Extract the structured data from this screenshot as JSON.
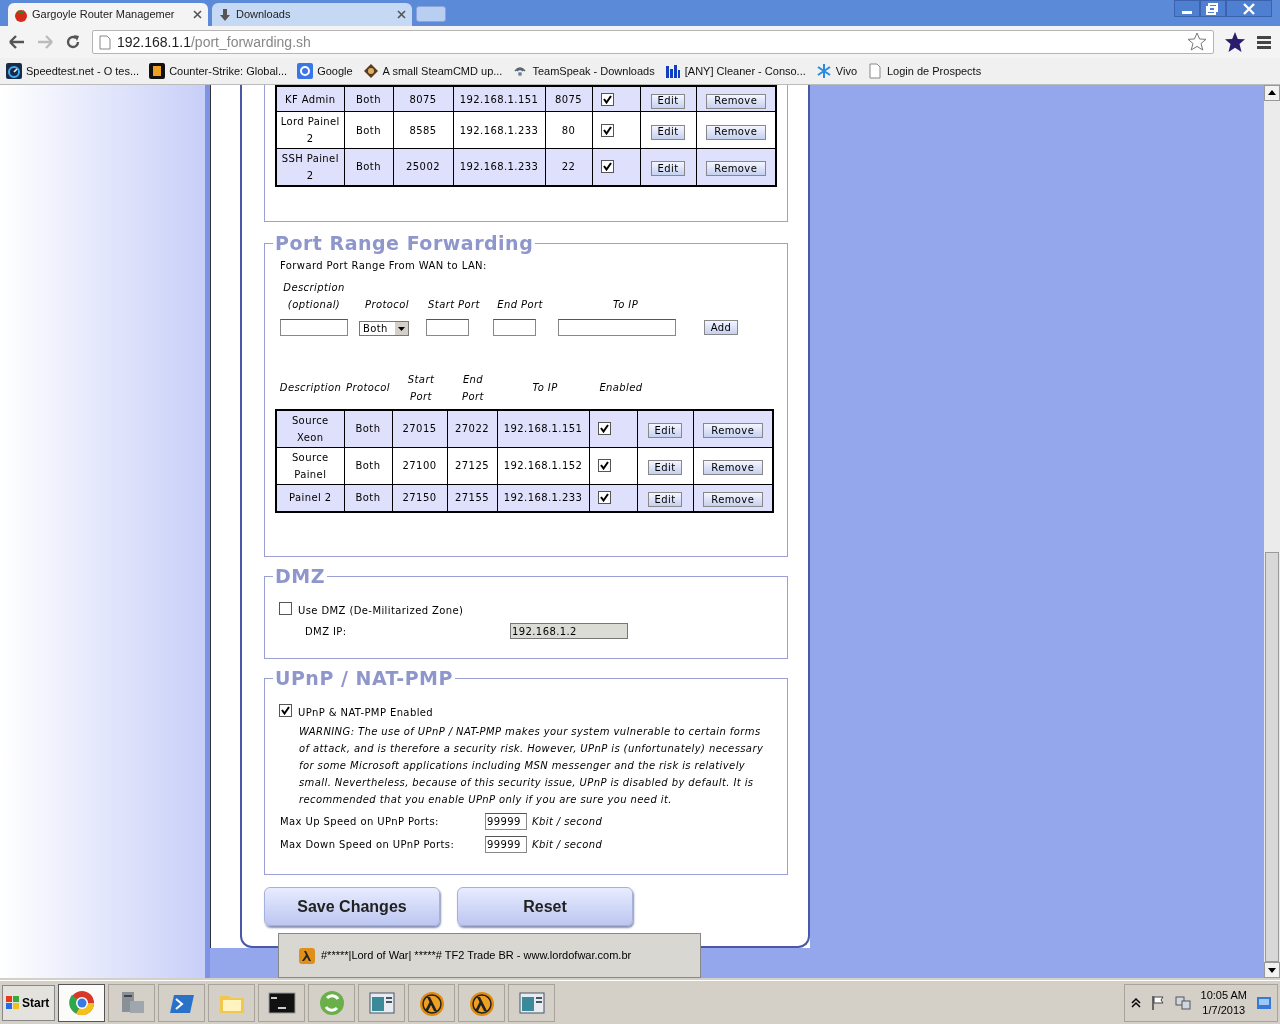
{
  "browser": {
    "tabs": [
      {
        "title": "Gargoyle Router Managemer",
        "selected": true,
        "kind": "tomato"
      },
      {
        "title": "Downloads",
        "selected": false,
        "kind": "download"
      }
    ],
    "address": {
      "host": "192.168.1.1",
      "path": "/port_forwarding.sh"
    },
    "bookmarks": [
      {
        "label": "Speedtest.net - O tes...",
        "kind": "gauge"
      },
      {
        "label": "Counter-Strike: Global...",
        "kind": "s"
      },
      {
        "label": "Google",
        "kind": "g"
      },
      {
        "label": "A small SteamCMD up...",
        "kind": "diamond"
      },
      {
        "label": "TeamSpeak - Downloads",
        "kind": "wave"
      },
      {
        "label": "[ANY] Cleaner - Conso...",
        "kind": "bars"
      },
      {
        "label": "Vivo",
        "kind": "star"
      },
      {
        "label": "Login de Prospects",
        "kind": "page"
      }
    ]
  },
  "port_forwarding": {
    "rows": [
      {
        "description": "KF Admin",
        "protocol": "Both",
        "from_port": "8075",
        "to_ip": "192.168.1.151",
        "to_port": "8075",
        "enabled": true,
        "edit_label": "Edit",
        "remove_label": "Remove"
      },
      {
        "description": "Lord Painel 2",
        "protocol": "Both",
        "from_port": "8585",
        "to_ip": "192.168.1.233",
        "to_port": "80",
        "enabled": true,
        "edit_label": "Edit",
        "remove_label": "Remove"
      },
      {
        "description": "SSH Painel 2",
        "protocol": "Both",
        "from_port": "25002",
        "to_ip": "192.168.1.233",
        "to_port": "22",
        "enabled": true,
        "edit_label": "Edit",
        "remove_label": "Remove"
      }
    ]
  },
  "port_range": {
    "title": "Port Range Forwarding",
    "intro": "Forward Port Range From WAN to LAN:",
    "form_labels": [
      "Description (optional)",
      "Protocol",
      "Start Port",
      "End Port",
      "To IP"
    ],
    "protocol_value": "Both",
    "add_label": "Add",
    "columns": [
      "Description",
      "Protocol",
      "Start Port",
      "End Port",
      "To IP",
      "Enabled"
    ],
    "rows": [
      {
        "description": "Source Xeon",
        "protocol": "Both",
        "start_port": "27015",
        "end_port": "27022",
        "to_ip": "192.168.1.151",
        "enabled": true,
        "edit_label": "Edit",
        "remove_label": "Remove"
      },
      {
        "description": "Source Painel",
        "protocol": "Both",
        "start_port": "27100",
        "end_port": "27125",
        "to_ip": "192.168.1.152",
        "enabled": true,
        "edit_label": "Edit",
        "remove_label": "Remove"
      },
      {
        "description": "Painel 2",
        "protocol": "Both",
        "start_port": "27150",
        "end_port": "27155",
        "to_ip": "192.168.1.233",
        "enabled": true,
        "edit_label": "Edit",
        "remove_label": "Remove"
      }
    ]
  },
  "dmz": {
    "title": "DMZ",
    "label": "Use DMZ (De-Militarized Zone)",
    "checked": false,
    "ip_label": "DMZ IP:",
    "ip_value": "192.168.1.2",
    "ip_disabled": true
  },
  "upnp": {
    "title": "UPnP / NAT-PMP",
    "label": "UPnP & NAT-PMP Enabled",
    "checked": true,
    "warning": "WARNING: The use of UPnP / NAT-PMP makes your system vulnerable to certain forms of attack, and is therefore a security risk. However, UPnP is (unfortunately) necessary for some Microsoft applications including MSN messenger and the risk is relatively small. Nevertheless, because of this security issue, UPnP is disabled by default. It is recommended that you enable UPnP only if you are sure you need it.",
    "speeds": [
      {
        "label": "Max Up Speed on UPnP Ports:",
        "value": "99999",
        "unit": "Kbit / second"
      },
      {
        "label": "Max Down Speed on UPnP Ports:",
        "value": "99999",
        "unit": "Kbit / second"
      }
    ]
  },
  "buttons": [
    "Save Changes",
    "Reset"
  ],
  "tooltip": "#*****|Lord of War| *****# TF2 Trade BR - www.lordofwar.com.br",
  "taskbar": {
    "start": "Start",
    "items": [
      {
        "kind": "browser",
        "selected": true
      },
      {
        "kind": "server",
        "selected": false
      },
      {
        "kind": "shell",
        "selected": false
      },
      {
        "kind": "folder",
        "selected": false
      },
      {
        "kind": "terminal",
        "selected": false
      },
      {
        "kind": "recycle",
        "selected": false
      },
      {
        "kind": "window",
        "selected": false
      },
      {
        "kind": "lambda",
        "selected": false
      },
      {
        "kind": "lambda",
        "selected": false
      },
      {
        "kind": "window",
        "selected": false
      }
    ],
    "time": "10:05 AM",
    "date": "1/7/2013"
  }
}
